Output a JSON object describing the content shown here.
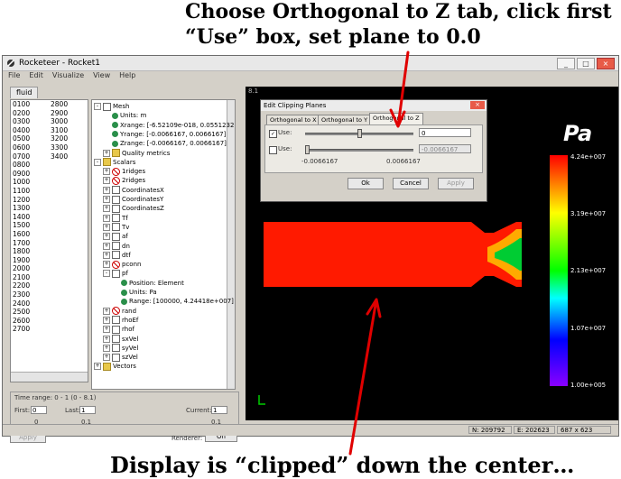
{
  "annotations": {
    "top_line1": "Choose Orthogonal to Z tab, click first",
    "top_line2": "“Use” box, set plane to 0.0",
    "bottom": "Display is “clipped” down the center…"
  },
  "window": {
    "title": "Rocketeer - Rocket1",
    "controls": [
      "_",
      "□",
      "×"
    ],
    "menu": [
      "File",
      "Edit",
      "Visualize",
      "View",
      "Help"
    ]
  },
  "left_panel": {
    "tab": "fluid",
    "rows": [
      [
        "0100",
        "2800"
      ],
      [
        "0200",
        "2900"
      ],
      [
        "0300",
        "3000"
      ],
      [
        "0400",
        "3100"
      ],
      [
        "0500",
        "3200"
      ],
      [
        "0600",
        "3300"
      ],
      [
        "0700",
        "3400"
      ],
      [
        "0800",
        ""
      ],
      [
        "0900",
        ""
      ],
      [
        "1000",
        ""
      ],
      [
        "1100",
        ""
      ],
      [
        "1200",
        ""
      ],
      [
        "1300",
        ""
      ],
      [
        "1400",
        ""
      ],
      [
        "1500",
        ""
      ],
      [
        "1600",
        ""
      ],
      [
        "1700",
        ""
      ],
      [
        "1800",
        ""
      ],
      [
        "1900",
        ""
      ],
      [
        "2000",
        ""
      ],
      [
        "2100",
        ""
      ],
      [
        "2200",
        ""
      ],
      [
        "2300",
        ""
      ],
      [
        "2400",
        ""
      ],
      [
        "2500",
        ""
      ],
      [
        "2600",
        ""
      ],
      [
        "2700",
        ""
      ]
    ],
    "tree": [
      {
        "label": "Mesh",
        "indent": 0,
        "icon": "page",
        "exp": "-"
      },
      {
        "label": "Units: m",
        "indent": 1,
        "icon": "ball",
        "exp": ""
      },
      {
        "label": "Xrange: [-6.52109e-018, 0.0551232]",
        "indent": 1,
        "icon": "ball",
        "exp": ""
      },
      {
        "label": "Yrange: [-0.0066167, 0.0066167]",
        "indent": 1,
        "icon": "ball",
        "exp": ""
      },
      {
        "label": "Zrange: [-0.0066167, 0.0066167]",
        "indent": 1,
        "icon": "ball",
        "exp": ""
      },
      {
        "label": "Quality metrics",
        "indent": 1,
        "icon": "folder",
        "exp": "+"
      },
      {
        "label": "Scalars",
        "indent": 0,
        "icon": "folder",
        "exp": "-"
      },
      {
        "label": "1ridges",
        "indent": 1,
        "icon": "nofill",
        "exp": "+"
      },
      {
        "label": "2ridges",
        "indent": 1,
        "icon": "nofill",
        "exp": "+"
      },
      {
        "label": "CoordinatesX",
        "indent": 1,
        "icon": "page",
        "exp": "+"
      },
      {
        "label": "CoordinatesY",
        "indent": 1,
        "icon": "page",
        "exp": "+"
      },
      {
        "label": "CoordinatesZ",
        "indent": 1,
        "icon": "page",
        "exp": "+"
      },
      {
        "label": "Tf",
        "indent": 1,
        "icon": "page",
        "exp": "+"
      },
      {
        "label": "Tv",
        "indent": 1,
        "icon": "page",
        "exp": "+"
      },
      {
        "label": "af",
        "indent": 1,
        "icon": "page",
        "exp": "+"
      },
      {
        "label": "dn",
        "indent": 1,
        "icon": "page",
        "exp": "+"
      },
      {
        "label": "dtf",
        "indent": 1,
        "icon": "page",
        "exp": "+"
      },
      {
        "label": "pconn",
        "indent": 1,
        "icon": "nofill",
        "exp": "+"
      },
      {
        "label": "pf",
        "indent": 1,
        "icon": "page",
        "exp": "-"
      },
      {
        "label": "Position: Element",
        "indent": 2,
        "icon": "ball",
        "exp": ""
      },
      {
        "label": "Units: Pa",
        "indent": 2,
        "icon": "ball",
        "exp": ""
      },
      {
        "label": "Range: [100000, 4.24418e+007]",
        "indent": 2,
        "icon": "ball",
        "exp": ""
      },
      {
        "label": "rand",
        "indent": 1,
        "icon": "nofill",
        "exp": "+"
      },
      {
        "label": "rhoEf",
        "indent": 1,
        "icon": "page",
        "exp": "+"
      },
      {
        "label": "rhof",
        "indent": 1,
        "icon": "page",
        "exp": "+"
      },
      {
        "label": "sxVel",
        "indent": 1,
        "icon": "page",
        "exp": "+"
      },
      {
        "label": "syVel",
        "indent": 1,
        "icon": "page",
        "exp": "+"
      },
      {
        "label": "szVel",
        "indent": 1,
        "icon": "page",
        "exp": "+"
      },
      {
        "label": "Vectors",
        "indent": 0,
        "icon": "folder",
        "exp": "+"
      }
    ],
    "time": {
      "range_label": "Time range: 0 - 1 (0 - 8.1)",
      "first_label": "First:",
      "first_value": "0",
      "first_sub": "0",
      "last_label": "Last:",
      "last_value": "1",
      "last_sub": "0.1",
      "current_label": "Current:",
      "current_value": "1",
      "current_sub": "0.1"
    },
    "apply": "Apply",
    "renderer_label": "Renderer:",
    "renderer_value": "On"
  },
  "viewport": {
    "label": "8.1",
    "dialog": {
      "title": "Edit Clipping Planes",
      "tabs": [
        "Orthogonal to X",
        "Orthogonal to Y",
        "Orthogonal to Z"
      ],
      "active_tab": 2,
      "row1": {
        "checked": true,
        "label": "Use:",
        "value": "0",
        "thumb_fraction": 0.5
      },
      "row2": {
        "checked": false,
        "label": "Use:",
        "value": "-0.0066167",
        "thumb_fraction": 0.0
      },
      "min_label": "-0.0066167",
      "max_label": "0.0066167",
      "ok": "Ok",
      "cancel": "Cancel",
      "apply": "Apply"
    },
    "colorbar": {
      "unit": "Pa",
      "ticks": [
        "4.24e+007",
        "3.19e+007",
        "2.13e+007",
        "1.07e+007",
        "1.00e+005"
      ]
    },
    "field_color": "#ff1a00",
    "axis_color": "#00cc00"
  },
  "status": {
    "n": "N: 209792",
    "e": "E: 202623",
    "size": "687 x 623"
  }
}
